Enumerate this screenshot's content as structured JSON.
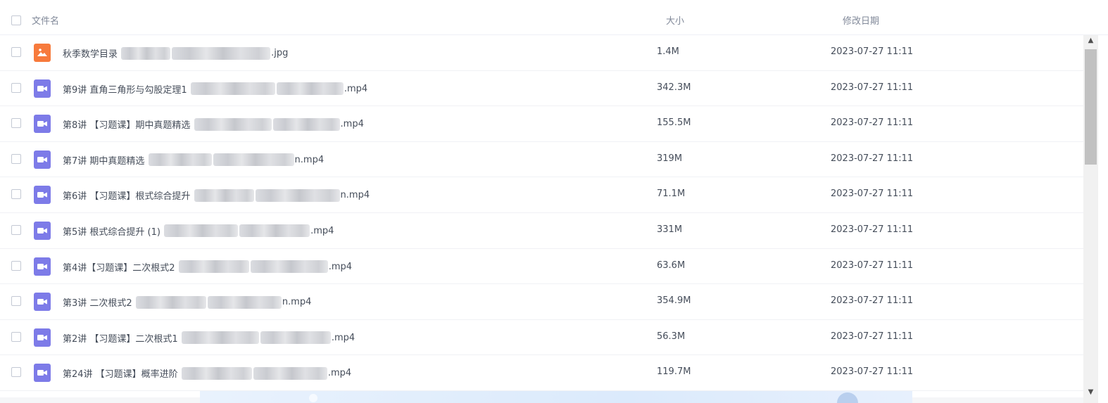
{
  "header": {
    "name_label": "文件名",
    "size_label": "大小",
    "date_label": "修改日期"
  },
  "colors": {
    "video_icon": "#7d7be8",
    "image_icon": "#f77a3c"
  },
  "files": [
    {
      "prefix": "秋季数学目录 ",
      "ext": ".jpg",
      "type": "image",
      "size": "1.4M",
      "date": "2023-07-27 11:11"
    },
    {
      "prefix": "第9讲 直角三角形与勾股定理1 ",
      "ext": ".mp4",
      "type": "video",
      "size": "342.3M",
      "date": "2023-07-27 11:11"
    },
    {
      "prefix": "第8讲 【习题课】期中真题精选 ",
      "ext": ".mp4",
      "type": "video",
      "size": "155.5M",
      "date": "2023-07-27 11:11"
    },
    {
      "prefix": "第7讲 期中真题精选 ",
      "ext": "n.mp4",
      "type": "video",
      "size": "319M",
      "date": "2023-07-27 11:11"
    },
    {
      "prefix": "第6讲 【习题课】根式综合提升 ",
      "ext": "n.mp4",
      "type": "video",
      "size": "71.1M",
      "date": "2023-07-27 11:11"
    },
    {
      "prefix": "第5讲 根式综合提升 (1) ",
      "ext": ".mp4",
      "type": "video",
      "size": "331M",
      "date": "2023-07-27 11:11"
    },
    {
      "prefix": "第4讲【习题课】二次根式2 ",
      "ext": ".mp4",
      "type": "video",
      "size": "63.6M",
      "date": "2023-07-27 11:11"
    },
    {
      "prefix": "第3讲 二次根式2 ",
      "ext": "n.mp4",
      "type": "video",
      "size": "354.9M",
      "date": "2023-07-27 11:11"
    },
    {
      "prefix": "第2讲 【习题课】二次根式1 ",
      "ext": ".mp4",
      "type": "video",
      "size": "56.3M",
      "date": "2023-07-27 11:11"
    },
    {
      "prefix": "第24讲 【习题课】概率进阶 ",
      "ext": ".mp4",
      "type": "video",
      "size": "119.7M",
      "date": "2023-07-27 11:11"
    }
  ]
}
